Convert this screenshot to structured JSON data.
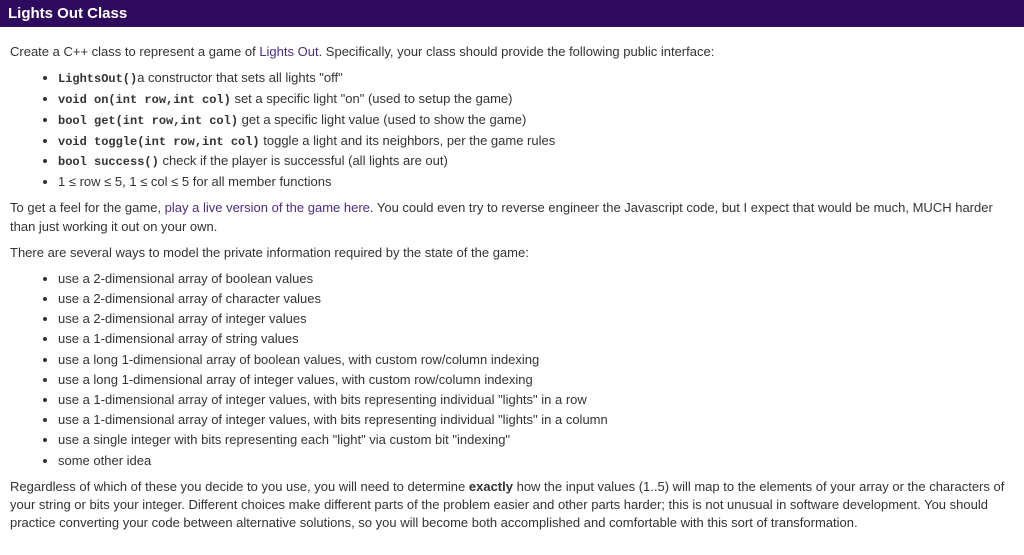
{
  "header": {
    "title": "Lights Out Class"
  },
  "para1": {
    "pre": "Create a C++ class to represent a game of ",
    "link": "Lights Out",
    "post": ". Specifically, your class should provide the following public interface:"
  },
  "interface": [
    {
      "code": "LightsOut()",
      "desc": "a constructor that sets all lights \"off\""
    },
    {
      "code": "void on(int row,int col)",
      "desc": " set a specific light \"on\" (used to setup the game)"
    },
    {
      "code": "bool get(int row,int col)",
      "desc": " get a specific light value (used to show the game)"
    },
    {
      "code": "void toggle(int row,int col)",
      "desc": " toggle a light and its neighbors, per the game rules"
    },
    {
      "code": "bool success()",
      "desc": " check if the player is successful (all lights are out)"
    },
    {
      "code": "",
      "desc": "1 ≤ row ≤ 5, 1 ≤ col ≤ 5 for all member functions"
    }
  ],
  "para2": {
    "pre": "To get a feel for the game, ",
    "link": "play a live version of the game here",
    "post": ". You could even try to reverse engineer the Javascript code, but I expect that would be much, MUCH harder than just working it out on your own."
  },
  "para3": "There are several ways to model the private information required by the state of the game:",
  "models": [
    "use a 2-dimensional array of boolean values",
    "use a 2-dimensional array of character values",
    "use a 2-dimensional array of integer values",
    "use a 1-dimensional array of string values",
    "use a long 1-dimensional array of boolean values, with custom row/column indexing",
    "use a long 1-dimensional array of integer values, with custom row/column indexing",
    "use a 1-dimensional array of integer values, with bits representing individual \"lights\" in a row",
    "use a 1-dimensional array of integer values, with bits representing individual \"lights\" in a column",
    "use a single integer with bits representing each \"light\" via custom bit \"indexing\"",
    "some other idea"
  ],
  "para4": {
    "pre": "Regardless of which of these you decide to you use, you will need to determine ",
    "strong": "exactly",
    "post": " how the input values (1..5) will map to the elements of your array or the characters of your string or bits your integer. Different choices make different parts of the problem easier and other parts harder; this is not unusual in software development. You should practice converting your code between alternative solutions, so you will become both accomplished and comfortable with this sort of transformation."
  }
}
